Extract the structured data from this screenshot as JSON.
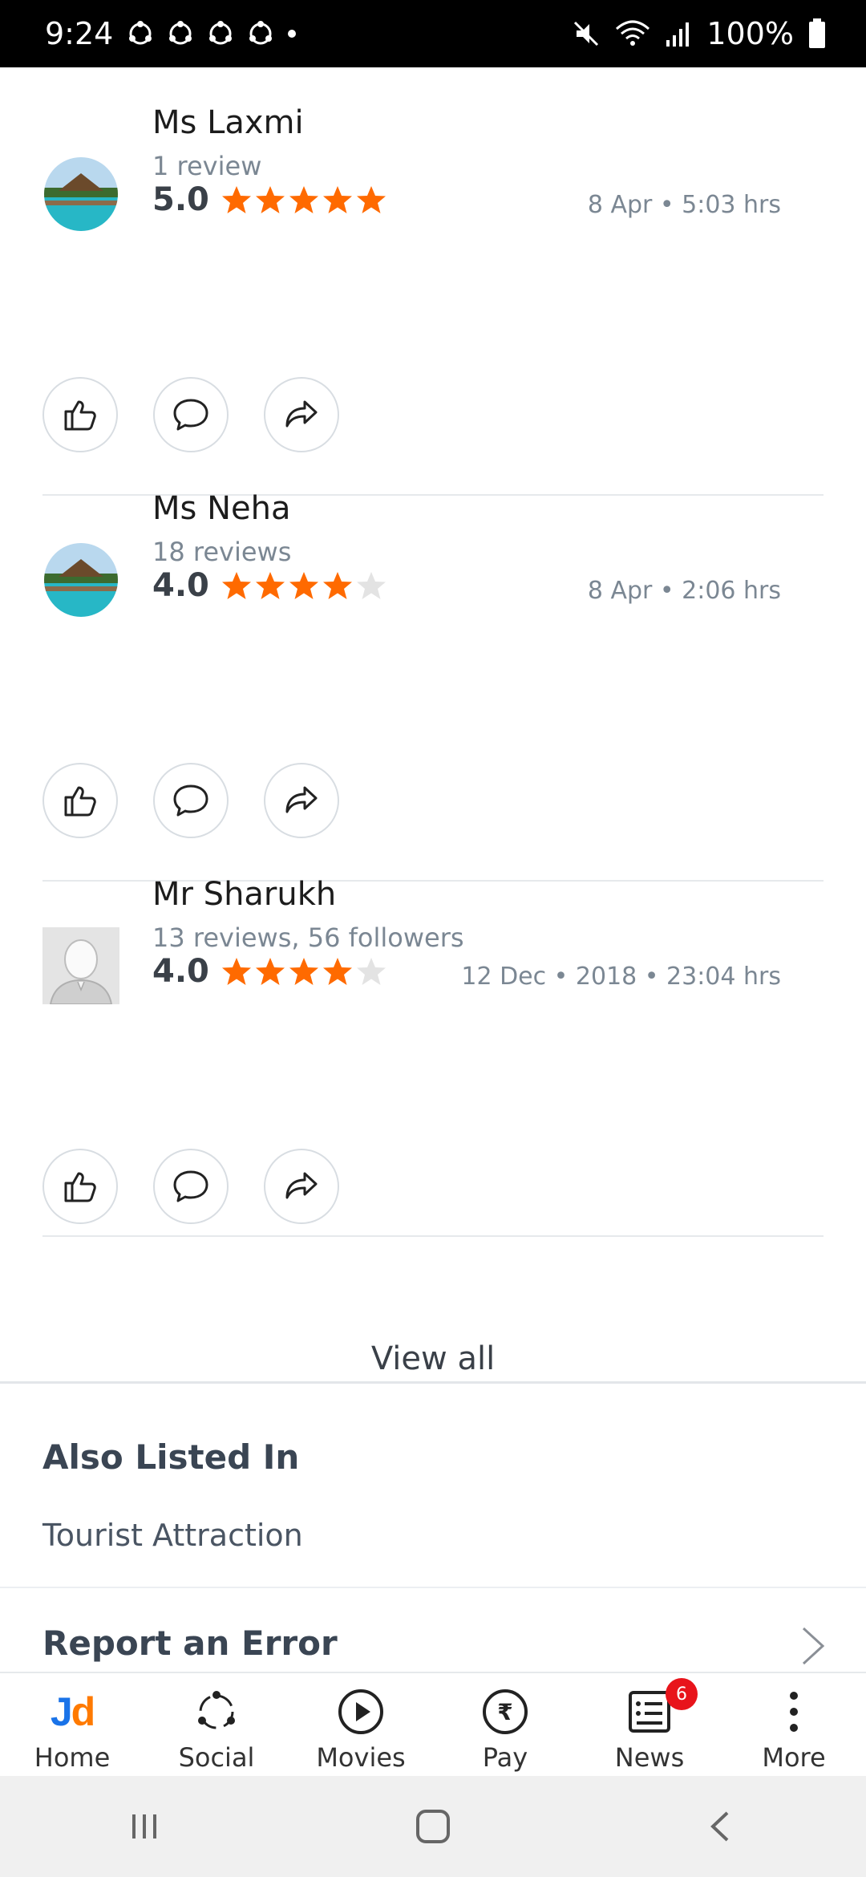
{
  "status_bar": {
    "time": "9:24",
    "battery": "100%"
  },
  "reviews": [
    {
      "name": "Ms Laxmi",
      "subtitle": "1 review",
      "score": "5.0",
      "stars": 5,
      "date": "8 Apr • 5:03 hrs",
      "avatar": "beach-resort-photo"
    },
    {
      "name": "Ms Neha",
      "subtitle": "18 reviews",
      "score": "4.0",
      "stars": 4,
      "date": "8 Apr • 2:06 hrs",
      "avatar": "beach-resort-photo"
    },
    {
      "name": "Mr Sharukh",
      "subtitle": "13 reviews, 56 followers",
      "score": "4.0",
      "stars": 4,
      "date": "12 Dec • 2018 • 23:04 hrs",
      "avatar": "default-person-avatar"
    }
  ],
  "view_all": "View all",
  "also_listed": {
    "title": "Also Listed In",
    "item": "Tourist Attraction"
  },
  "report": "Report an Error",
  "bottom_nav": [
    {
      "label": "Home",
      "icon": "jd-logo"
    },
    {
      "label": "Social",
      "icon": "social-icon"
    },
    {
      "label": "Movies",
      "icon": "play-icon"
    },
    {
      "label": "Pay",
      "icon": "rupee-icon"
    },
    {
      "label": "News",
      "icon": "news-icon",
      "badge": "6"
    },
    {
      "label": "More",
      "icon": "more-vertical-icon"
    }
  ],
  "colors": {
    "star_filled": "#ff6a00",
    "star_empty": "#e3e3e3",
    "badge": "#e8141b"
  }
}
